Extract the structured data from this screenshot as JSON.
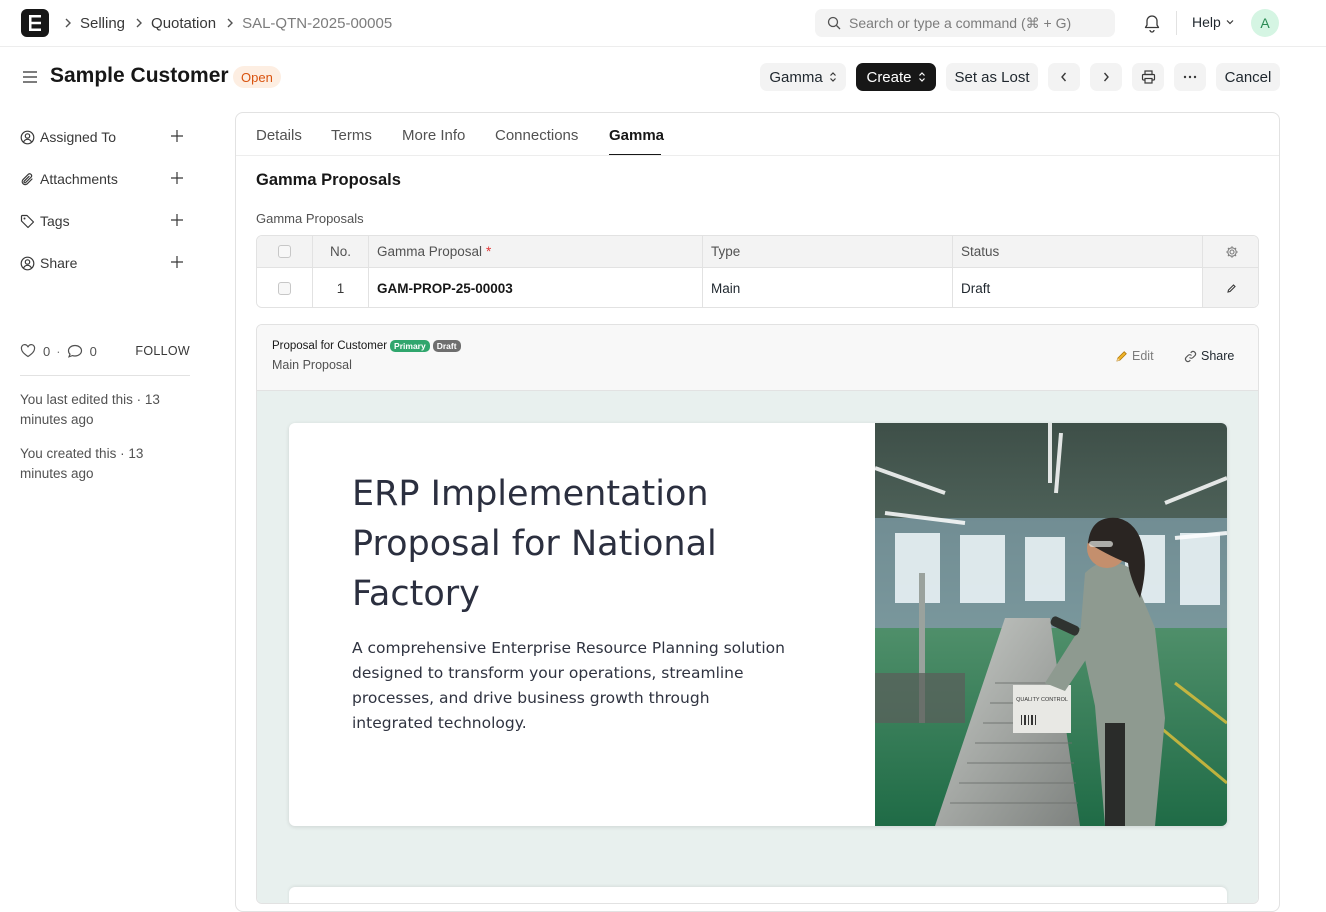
{
  "navbar": {
    "breadcrumbs": [
      "Selling",
      "Quotation",
      "SAL-QTN-2025-00005"
    ],
    "search_placeholder": "Search or type a command (⌘ + G)",
    "help_label": "Help",
    "avatar_initial": "A"
  },
  "header": {
    "title": "Sample Customer",
    "status": "Open",
    "buttons": {
      "gamma": "Gamma",
      "create": "Create",
      "set_as_lost": "Set as Lost",
      "cancel": "Cancel"
    }
  },
  "sidebar": {
    "items": [
      {
        "label": "Assigned To",
        "icon": "user-circle-icon"
      },
      {
        "label": "Attachments",
        "icon": "paperclip-icon"
      },
      {
        "label": "Tags",
        "icon": "tag-icon"
      },
      {
        "label": "Share",
        "icon": "share-user-icon"
      }
    ],
    "likes": "0",
    "comments": "0",
    "follow_label": "FOLLOW",
    "last_edited": "You last edited this · 13 minutes ago",
    "created": "You created this · 13 minutes ago"
  },
  "tabs": [
    "Details",
    "Terms",
    "More Info",
    "Connections",
    "Gamma"
  ],
  "active_tab": "Gamma",
  "section": {
    "title": "Gamma Proposals",
    "field_label": "Gamma Proposals"
  },
  "table": {
    "columns": [
      "No.",
      "Gamma Proposal",
      "Type",
      "Status"
    ],
    "rows": [
      {
        "no": "1",
        "proposal": "GAM-PROP-25-00003",
        "type": "Main",
        "status": "Draft"
      }
    ]
  },
  "proposal_card": {
    "title": "Proposal for Customer",
    "badges": [
      "Primary",
      "Draft"
    ],
    "subtitle": "Main Proposal",
    "edit_label": "Edit",
    "share_label": "Share"
  },
  "slide": {
    "title": "ERP Implementation Proposal for National Factory",
    "description": "A comprehensive Enterprise Resource Planning solution designed to transform your operations, streamline processes, and drive business growth through integrated technology.",
    "image_label": "QUALITY CONTROL"
  },
  "colors": {
    "accent": "#171717",
    "open_status": "#d9530f",
    "primary_badge": "#30a66d",
    "slide_background": "#e8f0ee"
  }
}
